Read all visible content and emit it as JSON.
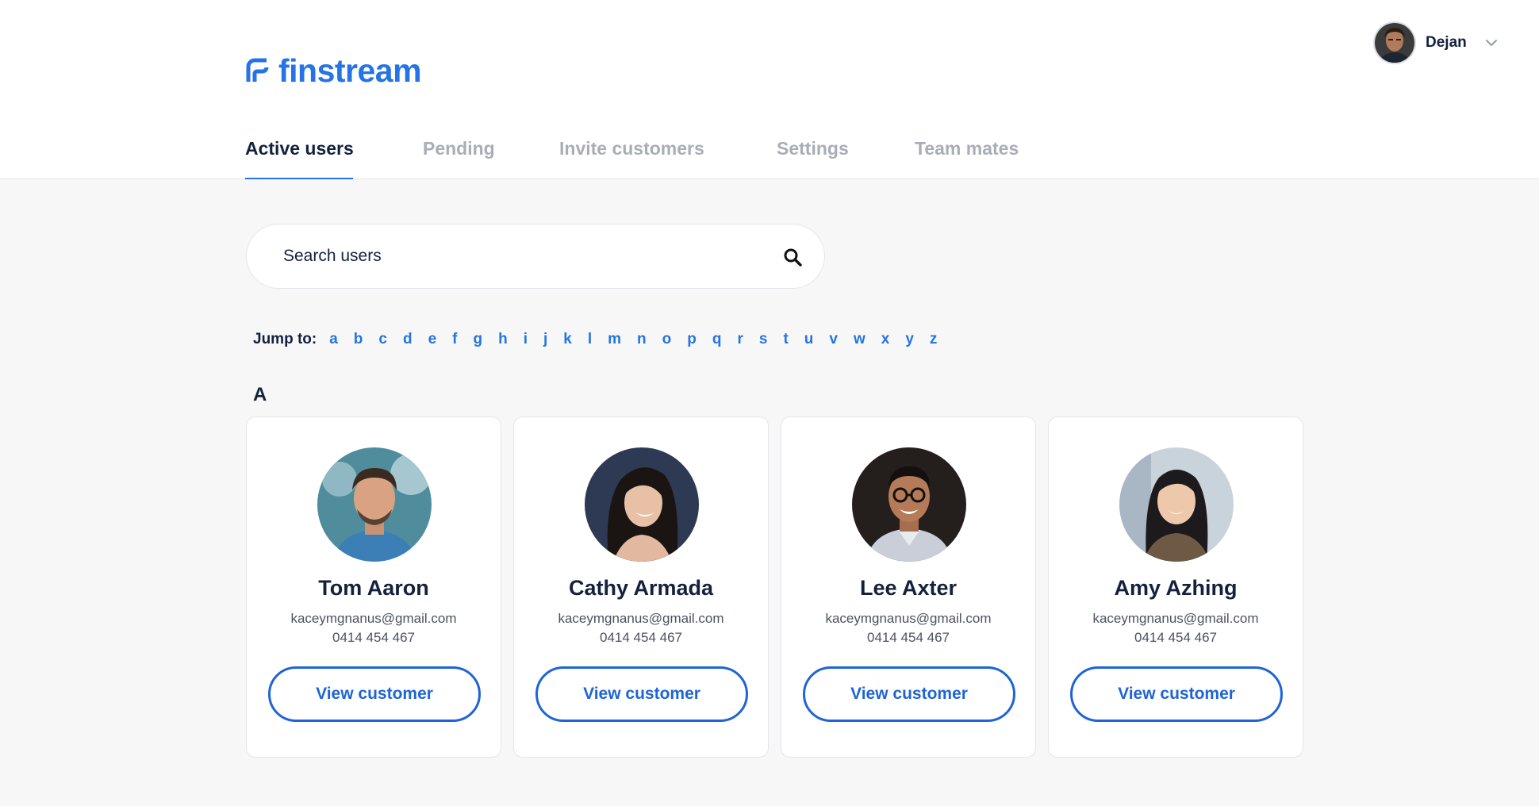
{
  "brand": {
    "name": "finstream",
    "color": "#2474e5"
  },
  "user_menu": {
    "name": "Dejan",
    "avatar_icon": "user-avatar",
    "chevron_icon": "chevron-down-icon"
  },
  "tabs": [
    {
      "label": "Active users",
      "active": true
    },
    {
      "label": "Pending",
      "active": false
    },
    {
      "label": "Invite customers",
      "active": false
    },
    {
      "label": "Settings",
      "active": false
    },
    {
      "label": "Team mates",
      "active": false
    }
  ],
  "search": {
    "placeholder": "Search users",
    "value": "",
    "icon": "search-icon"
  },
  "jump": {
    "label": "Jump to:",
    "letters": [
      "a",
      "b",
      "c",
      "d",
      "e",
      "f",
      "g",
      "h",
      "i",
      "j",
      "k",
      "l",
      "m",
      "n",
      "o",
      "p",
      "q",
      "r",
      "s",
      "t",
      "u",
      "v",
      "w",
      "x",
      "y",
      "z"
    ]
  },
  "section": {
    "letter": "A"
  },
  "customers": [
    {
      "name": "Tom Aaron",
      "email": "kaceymgnanus@gmail.com",
      "phone": "0414 454 467",
      "button": "View customer"
    },
    {
      "name": "Cathy Armada",
      "email": "kaceymgnanus@gmail.com",
      "phone": "0414 454 467",
      "button": "View customer"
    },
    {
      "name": "Lee Axter",
      "email": "kaceymgnanus@gmail.com",
      "phone": "0414 454 467",
      "button": "View customer"
    },
    {
      "name": "Amy Azhing",
      "email": "kaceymgnanus@gmail.com",
      "phone": "0414 454 467",
      "button": "View customer"
    }
  ],
  "colors": {
    "accent": "#2474e5",
    "button_border": "#1f64d6",
    "text_dark": "#14213d",
    "text_muted": "#a8adb7",
    "page_bg": "#f7f7f7"
  }
}
